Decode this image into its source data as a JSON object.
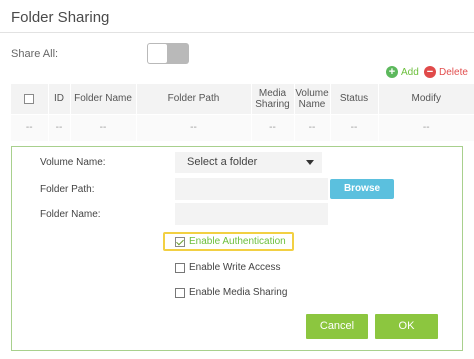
{
  "page": {
    "title": "Folder Sharing"
  },
  "share_all": {
    "label": "Share All:",
    "enabled": false
  },
  "actions": {
    "add_label": "Add",
    "delete_label": "Delete",
    "add_icon": "plus-circle-icon",
    "delete_icon": "minus-circle-icon"
  },
  "table": {
    "headers": [
      "ID",
      "Folder Name",
      "Folder Path",
      "Media Sharing",
      "Volume Name",
      "Status",
      "Modify"
    ],
    "header_lines": [
      [
        "ID"
      ],
      [
        "Folder Name"
      ],
      [
        "Folder Path"
      ],
      [
        "Media",
        "Sharing"
      ],
      [
        "Volume",
        "Name"
      ],
      [
        "Status"
      ],
      [
        "Modify"
      ]
    ],
    "rows": [
      [
        "--",
        "--",
        "--",
        "--",
        "--",
        "--",
        "--",
        "--"
      ]
    ]
  },
  "form": {
    "volume_label": "Volume Name:",
    "volume_value": "Select a folder",
    "path_label": "Folder Path:",
    "path_value": "",
    "name_label": "Folder Name:",
    "name_value": "",
    "browse_label": "Browse",
    "auth_label": "Enable Authentication",
    "auth_checked": true,
    "write_label": "Enable Write Access",
    "write_checked": false,
    "media_label": "Enable Media Sharing",
    "media_checked": false,
    "cancel_label": "Cancel",
    "ok_label": "OK"
  },
  "colors": {
    "accent_green": "#8cc63f",
    "browse_blue": "#5bc0de",
    "delete_red": "#e04a4a",
    "highlight": "#f2d043"
  }
}
